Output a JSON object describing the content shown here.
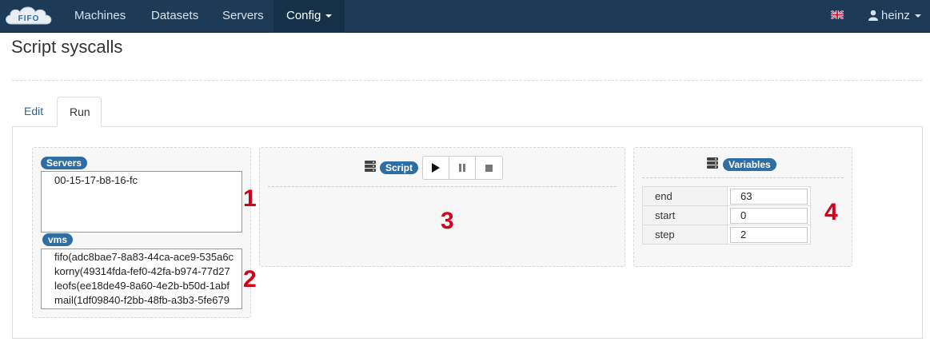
{
  "navbar": {
    "logo_text": "FIFO",
    "items": [
      "Machines",
      "Datasets",
      "Servers",
      "Config"
    ],
    "flag_icon": "uk-flag-icon",
    "user": "heinz"
  },
  "page": {
    "title": "Script syscalls"
  },
  "tabs": [
    "Edit",
    "Run"
  ],
  "servers_panel": {
    "servers_label": "Servers",
    "servers": [
      "00-15-17-b8-16-fc"
    ],
    "vms_label": "vms",
    "vms": [
      "fifo(adc8bae7-8a83-44ca-ace9-535a6c",
      "korny(49314fda-fef0-42fa-b974-77d27",
      "leofs(ee18de49-8a60-4e2b-b50d-1abf",
      "mail(1df09840-f2bb-48fb-a3b3-5fe679"
    ]
  },
  "script_panel": {
    "label": "Script",
    "controls": [
      "play-icon",
      "pause-icon",
      "stop-icon"
    ]
  },
  "variables_panel": {
    "label": "Variables",
    "rows": [
      {
        "name": "end",
        "value": "63"
      },
      {
        "name": "start",
        "value": "0"
      },
      {
        "name": "step",
        "value": "2"
      }
    ]
  },
  "annotations": [
    "1",
    "2",
    "3",
    "4"
  ],
  "colors": {
    "navbar": "#1d3a56",
    "badge": "#2f6ea3",
    "annotation": "#d0021b"
  }
}
